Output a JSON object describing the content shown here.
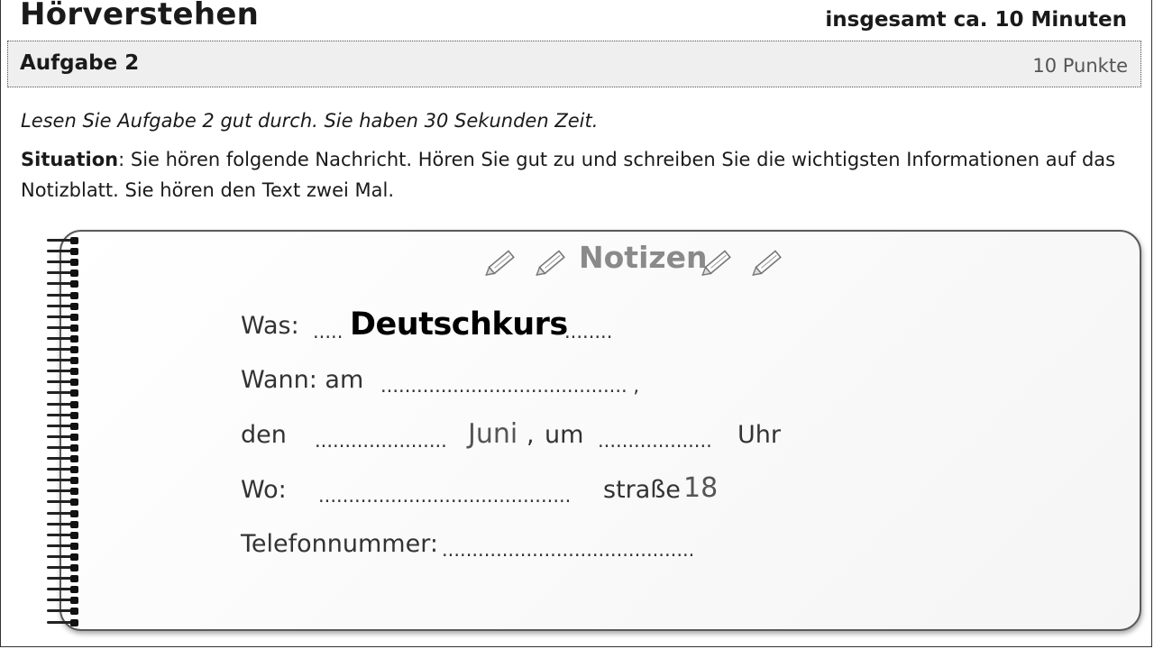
{
  "header": {
    "title": "Hörverstehen",
    "duration": "insgesamt ca. 10 Minuten"
  },
  "task": {
    "label": "Aufgabe 2",
    "points": "10 Punkte"
  },
  "instructions": {
    "reading": "Lesen Sie Aufgabe 2 gut durch. Sie haben 30 Sekunden Zeit.",
    "situation_label": "Situation",
    "situation_text": ": Sie hören folgende Nachricht. Hören Sie gut zu und schreiben Sie die wichtigsten Informationen auf das Notizblatt. Sie hören den Text zwei Mal."
  },
  "notes": {
    "title": "Notizen",
    "icons": [
      "pencil-icon",
      "pencil-icon",
      "pencil-icon",
      "pencil-icon"
    ],
    "was_label": "Was:",
    "was_dots_before": ".....",
    "was_answer": "Deutschkurs",
    "was_dots_after": "........",
    "wann_label": "Wann: am",
    "wann_dots": "......................................... ,",
    "den_label": "den",
    "den_dots": "......................",
    "month": "Juni",
    "comma": ",",
    "um_label": "um",
    "um_dots": "...................",
    "uhr_label": "Uhr",
    "wo_label": "Wo:",
    "wo_dots": "..........................................",
    "street_suffix": "straße",
    "house_number": "18",
    "phone_label": "Telefonnummer:",
    "phone_dots": ".........................................."
  },
  "colors": {
    "task_bar": "#efefef",
    "notes_title": "#8a8a8a"
  }
}
